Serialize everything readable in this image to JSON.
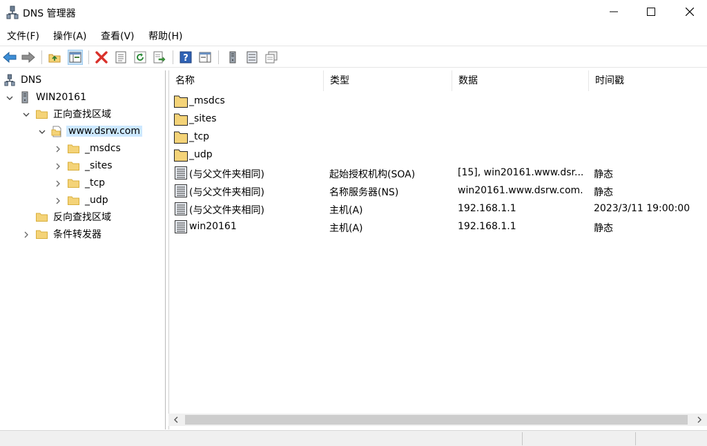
{
  "window": {
    "title": "DNS 管理器"
  },
  "menu": [
    {
      "label": "文件(F)"
    },
    {
      "label": "操作(A)"
    },
    {
      "label": "查看(V)"
    },
    {
      "label": "帮助(H)"
    }
  ],
  "toolbar": {
    "icons": [
      "back-arrow-icon",
      "forward-arrow-icon",
      "up-folder-icon",
      "show-tree-icon",
      "delete-icon",
      "properties-icon",
      "refresh-icon",
      "export-list-icon",
      "help-icon",
      "console-tree-icon",
      "server-icon",
      "records-icon",
      "forwarders-icon"
    ]
  },
  "tree": {
    "root": "DNS",
    "server": "WIN20161",
    "forward_zones": "正向查找区域",
    "zone": "www.dsrw.com",
    "subfolders": [
      "_msdcs",
      "_sites",
      "_tcp",
      "_udp"
    ],
    "reverse_zones": "反向查找区域",
    "conditional_forwarders": "条件转发器"
  },
  "list": {
    "columns": [
      "名称",
      "类型",
      "数据",
      "时间戳"
    ],
    "folders": [
      "_msdcs",
      "_sites",
      "_tcp",
      "_udp"
    ],
    "records": [
      {
        "name": "(与父文件夹相同)",
        "type": "起始授权机构(SOA)",
        "data": "[15], win20161.www.dsr...",
        "timestamp": "静态"
      },
      {
        "name": "(与父文件夹相同)",
        "type": "名称服务器(NS)",
        "data": "win20161.www.dsrw.com.",
        "timestamp": "静态"
      },
      {
        "name": "(与父文件夹相同)",
        "type": "主机(A)",
        "data": "192.168.1.1",
        "timestamp": "2023/3/11 19:00:00"
      },
      {
        "name": "win20161",
        "type": "主机(A)",
        "data": "192.168.1.1",
        "timestamp": "静态"
      }
    ]
  },
  "colors": {
    "selection": "#cce8ff",
    "folder": "#f4d378",
    "folder_edge": "#d8ae3a",
    "delete": "#d9302a",
    "help": "#2f62b5"
  }
}
